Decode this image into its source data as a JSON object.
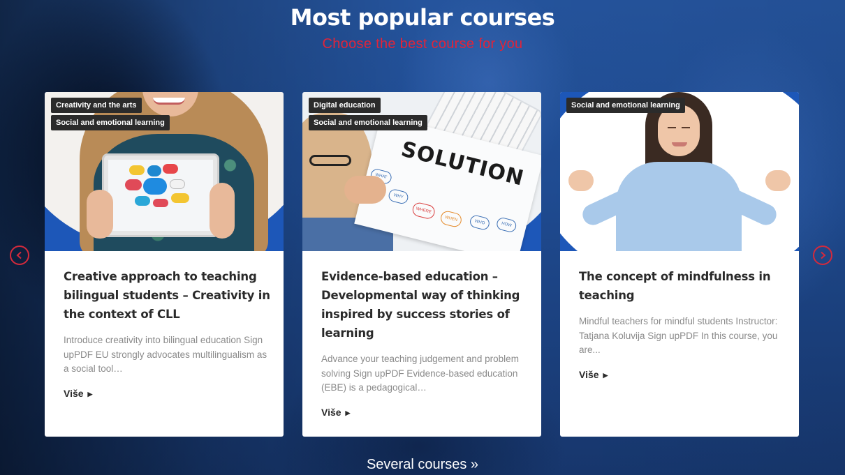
{
  "section": {
    "title": "Most popular courses",
    "subtitle": "Choose the best course for you",
    "footer_link": "Several courses »"
  },
  "colors": {
    "accent_red": "#e0243a",
    "card_blue": "#1d57b8",
    "tag_bg": "#2b2b2b"
  },
  "courses": [
    {
      "tags": [
        "Creativity and the arts",
        "Social and emotional learning"
      ],
      "title": "Creative approach to teaching bilingual students – Creativity in the context of CLL",
      "description": "Introduce creativity into bilingual education Sign upPDF EU strongly advocates multilingualism as a social tool…",
      "more": "Više",
      "image": "teacher holding tablet with speech bubbles"
    },
    {
      "tags": [
        "Digital education",
        "Social and emotional learning"
      ],
      "title": "Evidence-based education – Developmental way of thinking inspired by success stories of learning",
      "description": "Advance your teaching judgement and problem solving Sign upPDF Evidence-based education (EBE) is a pedagogical…",
      "more": "Više",
      "image": "notebook with SOLUTION written",
      "image_text": "SOLUTION",
      "bubbles": [
        "WHAT",
        "WHY",
        "WHERE",
        "WHEN",
        "WHO",
        "HOW"
      ]
    },
    {
      "tags": [
        "Social and emotional learning"
      ],
      "title": "The concept of mindfulness in teaching",
      "description": "Mindful teachers for mindful students Instructor: Tatjana Koluvija Sign upPDF In this course, you are...",
      "more": "Više",
      "image": "woman meditating"
    }
  ],
  "nav": {
    "prev_icon": "chevron-left-icon",
    "next_icon": "chevron-right-icon"
  }
}
